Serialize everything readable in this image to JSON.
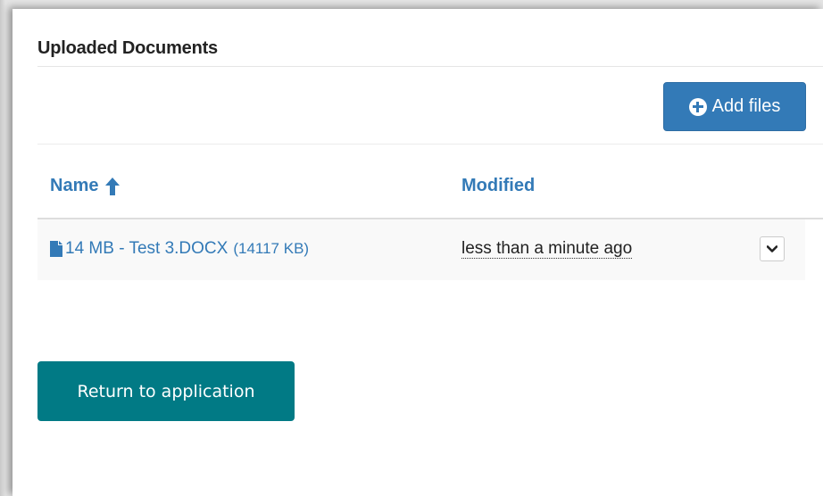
{
  "section": {
    "title": "Uploaded Documents"
  },
  "toolbar": {
    "add_files_label": "Add files",
    "add_icon": "plus-circle-icon"
  },
  "table": {
    "columns": [
      {
        "label": "Name",
        "sorted": "ascending",
        "sort_icon": "arrow-up-icon"
      },
      {
        "label": "Modified"
      }
    ],
    "rows": [
      {
        "file_icon": "document-icon",
        "name": "14 MB - Test 3.DOCX",
        "size": "(14117 KB)",
        "modified": "less than a minute ago",
        "action_icon": "chevron-down-icon"
      }
    ]
  },
  "footer": {
    "return_label": "Return to application"
  },
  "colors": {
    "primary": "#337ab7",
    "teal": "#017a85",
    "row_bg": "#f9f9f9"
  }
}
